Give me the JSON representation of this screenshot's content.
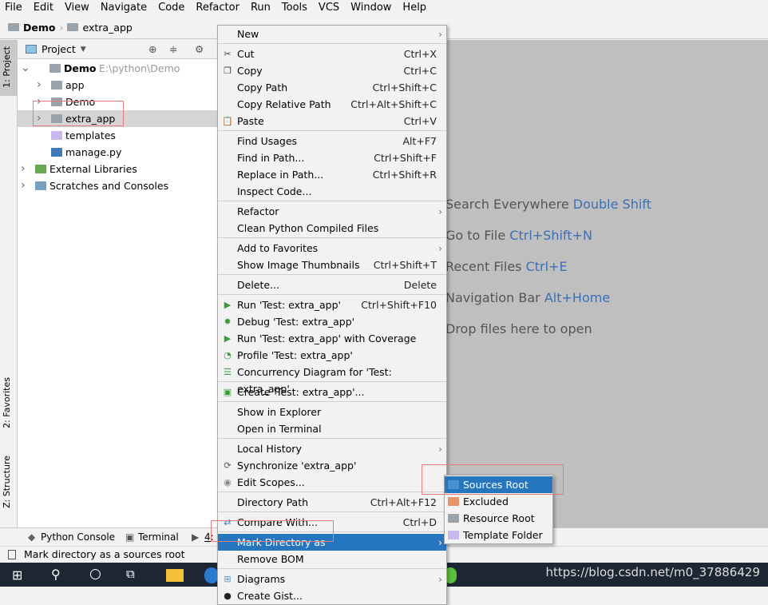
{
  "menubar": [
    "File",
    "Edit",
    "View",
    "Navigate",
    "Code",
    "Refactor",
    "Run",
    "Tools",
    "VCS",
    "Window",
    "Help"
  ],
  "breadcrumb": {
    "project": "Demo",
    "folder": "extra_app"
  },
  "left_strip": {
    "project": "1: Project",
    "favorites": "2: Favorites",
    "structure": "Z: Structure"
  },
  "project_panel": {
    "title": "Project",
    "tree": [
      {
        "label": "Demo",
        "extra": "E:\\python\\Demo"
      },
      {
        "label": "app"
      },
      {
        "label": "Demo"
      },
      {
        "label": "extra_app"
      },
      {
        "label": "templates"
      },
      {
        "label": "manage.py"
      },
      {
        "label": "External Libraries"
      },
      {
        "label": "Scratches and Consoles"
      }
    ]
  },
  "editor_hints": [
    {
      "text": "Search Everywhere",
      "key": "Double Shift"
    },
    {
      "text": "Go to File",
      "key": "Ctrl+Shift+N"
    },
    {
      "text": "Recent Files",
      "key": "Ctrl+E"
    },
    {
      "text": "Navigation Bar",
      "key": "Alt+Home"
    },
    {
      "text": "Drop files here to open",
      "key": ""
    }
  ],
  "context_menu": [
    {
      "label": "New",
      "arrow": true
    },
    {
      "sep": true
    },
    {
      "label": "Cut",
      "shortcut": "Ctrl+X",
      "icon": "✂"
    },
    {
      "label": "Copy",
      "shortcut": "Ctrl+C",
      "icon": "❐"
    },
    {
      "label": "Copy Path",
      "shortcut": "Ctrl+Shift+C"
    },
    {
      "label": "Copy Relative Path",
      "shortcut": "Ctrl+Alt+Shift+C"
    },
    {
      "label": "Paste",
      "shortcut": "Ctrl+V",
      "icon": "📋"
    },
    {
      "sep": true
    },
    {
      "label": "Find Usages",
      "shortcut": "Alt+F7"
    },
    {
      "label": "Find in Path...",
      "shortcut": "Ctrl+Shift+F"
    },
    {
      "label": "Replace in Path...",
      "shortcut": "Ctrl+Shift+R"
    },
    {
      "label": "Inspect Code..."
    },
    {
      "sep": true
    },
    {
      "label": "Refactor",
      "arrow": true
    },
    {
      "label": "Clean Python Compiled Files"
    },
    {
      "sep": true
    },
    {
      "label": "Add to Favorites",
      "arrow": true
    },
    {
      "label": "Show Image Thumbnails",
      "shortcut": "Ctrl+Shift+T"
    },
    {
      "sep": true
    },
    {
      "label": "Delete...",
      "shortcut": "Delete"
    },
    {
      "sep": true
    },
    {
      "label": "Run 'Test: extra_app'",
      "shortcut": "Ctrl+Shift+F10",
      "icon": "▶",
      "color": "#3a9a3a"
    },
    {
      "label": "Debug 'Test: extra_app'",
      "icon": "✹",
      "color": "#3a9a3a"
    },
    {
      "label": "Run 'Test: extra_app' with Coverage",
      "icon": "▶",
      "color": "#3a9a3a"
    },
    {
      "label": "Profile 'Test: extra_app'",
      "icon": "◔",
      "color": "#3a9a3a"
    },
    {
      "label": "Concurrency Diagram for 'Test: extra_app'",
      "icon": "☰",
      "color": "#3a9a3a"
    },
    {
      "sep": true
    },
    {
      "label": "Create 'Test: extra_app'...",
      "icon": "▣",
      "color": "#3a9a3a"
    },
    {
      "sep": true
    },
    {
      "label": "Show in Explorer"
    },
    {
      "label": "Open in Terminal"
    },
    {
      "sep": true
    },
    {
      "label": "Local History",
      "arrow": true
    },
    {
      "label": "Synchronize 'extra_app'",
      "icon": "⟳",
      "color": "#555"
    },
    {
      "label": "Edit Scopes...",
      "icon": "◉",
      "color": "#888"
    },
    {
      "sep": true
    },
    {
      "label": "Directory Path",
      "shortcut": "Ctrl+Alt+F12"
    },
    {
      "sep": true
    },
    {
      "label": "Compare With...",
      "shortcut": "Ctrl+D",
      "icon": "⇄",
      "color": "#2a7ac0"
    },
    {
      "sep": true
    },
    {
      "label": "Mark Directory as",
      "arrow": true,
      "selected": true
    },
    {
      "label": "Remove BOM"
    },
    {
      "sep": true
    },
    {
      "label": "Diagrams",
      "arrow": true,
      "icon": "⊞",
      "color": "#5a9ac0"
    },
    {
      "label": "Create Gist...",
      "icon": "●",
      "color": "#222"
    }
  ],
  "submenu": [
    {
      "label": "Sources Root",
      "color": "#4a90d0",
      "selected": true
    },
    {
      "label": "Excluded",
      "color": "#e8956a"
    },
    {
      "label": "Resource Root",
      "color": "#9aa3ab"
    },
    {
      "label": "Template Folder",
      "color": "#c9b8ef"
    }
  ],
  "bottom_tabs": [
    "Python Console",
    "Terminal",
    "4:"
  ],
  "status": "Mark directory as a sources root",
  "watermark": "https://blog.csdn.net/m0_37886429"
}
